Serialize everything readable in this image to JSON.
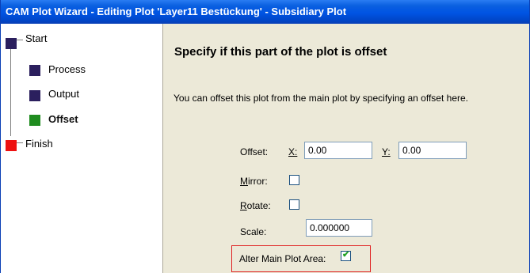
{
  "window": {
    "title": "CAM Plot Wizard - Editing Plot 'Layer11 Bestückung' - Subsidiary Plot"
  },
  "steps": [
    {
      "label": "Start",
      "color": "#2b1f5e",
      "active": false
    },
    {
      "label": "Process",
      "color": "#2b1f5e",
      "active": false
    },
    {
      "label": "Output",
      "color": "#2b1f5e",
      "active": false
    },
    {
      "label": "Offset",
      "color": "#1f8c1f",
      "active": true
    },
    {
      "label": "Finish",
      "color": "#ee1111",
      "active": false
    }
  ],
  "page": {
    "heading": "Specify if this part of the plot is offset",
    "description": "You can offset this plot from the main plot by specifying an offset here."
  },
  "form": {
    "offset_label": "Offset:",
    "x_label": "X:",
    "x_value": "0.00",
    "y_label": "Y:",
    "y_value": "0.00",
    "mirror_label": "Mirror:",
    "mirror_checked": false,
    "rotate_label": "Rotate:",
    "rotate_checked": false,
    "scale_label": "Scale:",
    "scale_value": "0.000000",
    "alter_label": "Alter Main Plot Area:",
    "alter_checked": true,
    "checkmark_glyph": "✔"
  }
}
